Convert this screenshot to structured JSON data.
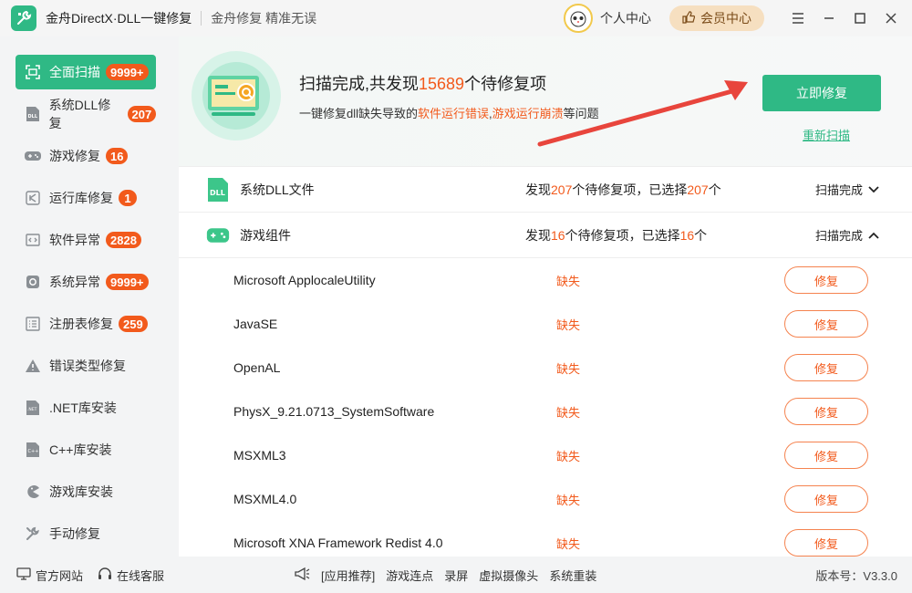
{
  "titlebar": {
    "app_title": "金舟DirectX·DLL一键修复",
    "slogan": "金舟修复 精准无误",
    "personal_center": "个人中心",
    "vip_center": "会员中心"
  },
  "sidebar": {
    "items": [
      {
        "label": "全面扫描",
        "badge": "9999+",
        "icon": "scan-icon"
      },
      {
        "label": "系统DLL修复",
        "badge": "207",
        "icon": "dll-icon"
      },
      {
        "label": "游戏修复",
        "badge": "16",
        "icon": "gamepad-icon"
      },
      {
        "label": "运行库修复",
        "badge": "1",
        "icon": "vs-icon"
      },
      {
        "label": "软件异常",
        "badge": "2828",
        "icon": "code-icon"
      },
      {
        "label": "系统异常",
        "badge": "9999+",
        "icon": "gear-icon"
      },
      {
        "label": "注册表修复",
        "badge": "259",
        "icon": "list-icon"
      },
      {
        "label": "错误类型修复",
        "badge": "",
        "icon": "warning-icon"
      },
      {
        "label": ".NET库安装",
        "badge": "",
        "icon": "net-icon"
      },
      {
        "label": "C++库安装",
        "badge": "",
        "icon": "cpp-icon"
      },
      {
        "label": "游戏库安装",
        "badge": "",
        "icon": "pacman-icon"
      },
      {
        "label": "手动修复",
        "badge": "",
        "icon": "wrench-icon"
      }
    ]
  },
  "banner": {
    "title_prefix": "扫描完成,共发现",
    "title_count": "15689",
    "title_suffix": "个待修复项",
    "sub_prefix": "一键修复dll缺失导致的",
    "sub_hl1": "软件运行错误",
    "sub_sep": ",",
    "sub_hl2": "游戏运行崩溃",
    "sub_suffix": "等问题",
    "fix_now": "立即修复",
    "rescan": "重新扫描"
  },
  "categories": [
    {
      "name": "系统DLL文件",
      "info_prefix": "发现",
      "found": "207",
      "info_mid": "个待修复项，已选择",
      "selected": "207",
      "info_suffix": "个",
      "status": "扫描完成",
      "icon": "dll-file-icon",
      "chevron": "chevron-down-icon"
    },
    {
      "name": "游戏组件",
      "info_prefix": "发现",
      "found": "16",
      "info_mid": "个待修复项，已选择",
      "selected": "16",
      "info_suffix": "个",
      "status": "扫描完成",
      "icon": "game-component-icon",
      "chevron": "chevron-up-icon"
    }
  ],
  "items": [
    {
      "name": "Microsoft ApplocaleUtility",
      "status": "缺失",
      "action": "修复"
    },
    {
      "name": "JavaSE",
      "status": "缺失",
      "action": "修复"
    },
    {
      "name": "OpenAL",
      "status": "缺失",
      "action": "修复"
    },
    {
      "name": "PhysX_9.21.0713_SystemSoftware",
      "status": "缺失",
      "action": "修复"
    },
    {
      "name": "MSXML3",
      "status": "缺失",
      "action": "修复"
    },
    {
      "name": "MSXML4.0",
      "status": "缺失",
      "action": "修复"
    },
    {
      "name": "Microsoft XNA Framework Redist 4.0",
      "status": "缺失",
      "action": "修复"
    }
  ],
  "footer": {
    "official_site": "官方网站",
    "online_service": "在线客服",
    "rec_label": "[应用推荐]",
    "rec_items": [
      "游戏连点",
      "录屏",
      "虚拟摄像头",
      "系统重装"
    ],
    "version": "版本号：V3.3.0"
  },
  "colors": {
    "accent": "#2fb985",
    "warning": "#f25a1c"
  }
}
